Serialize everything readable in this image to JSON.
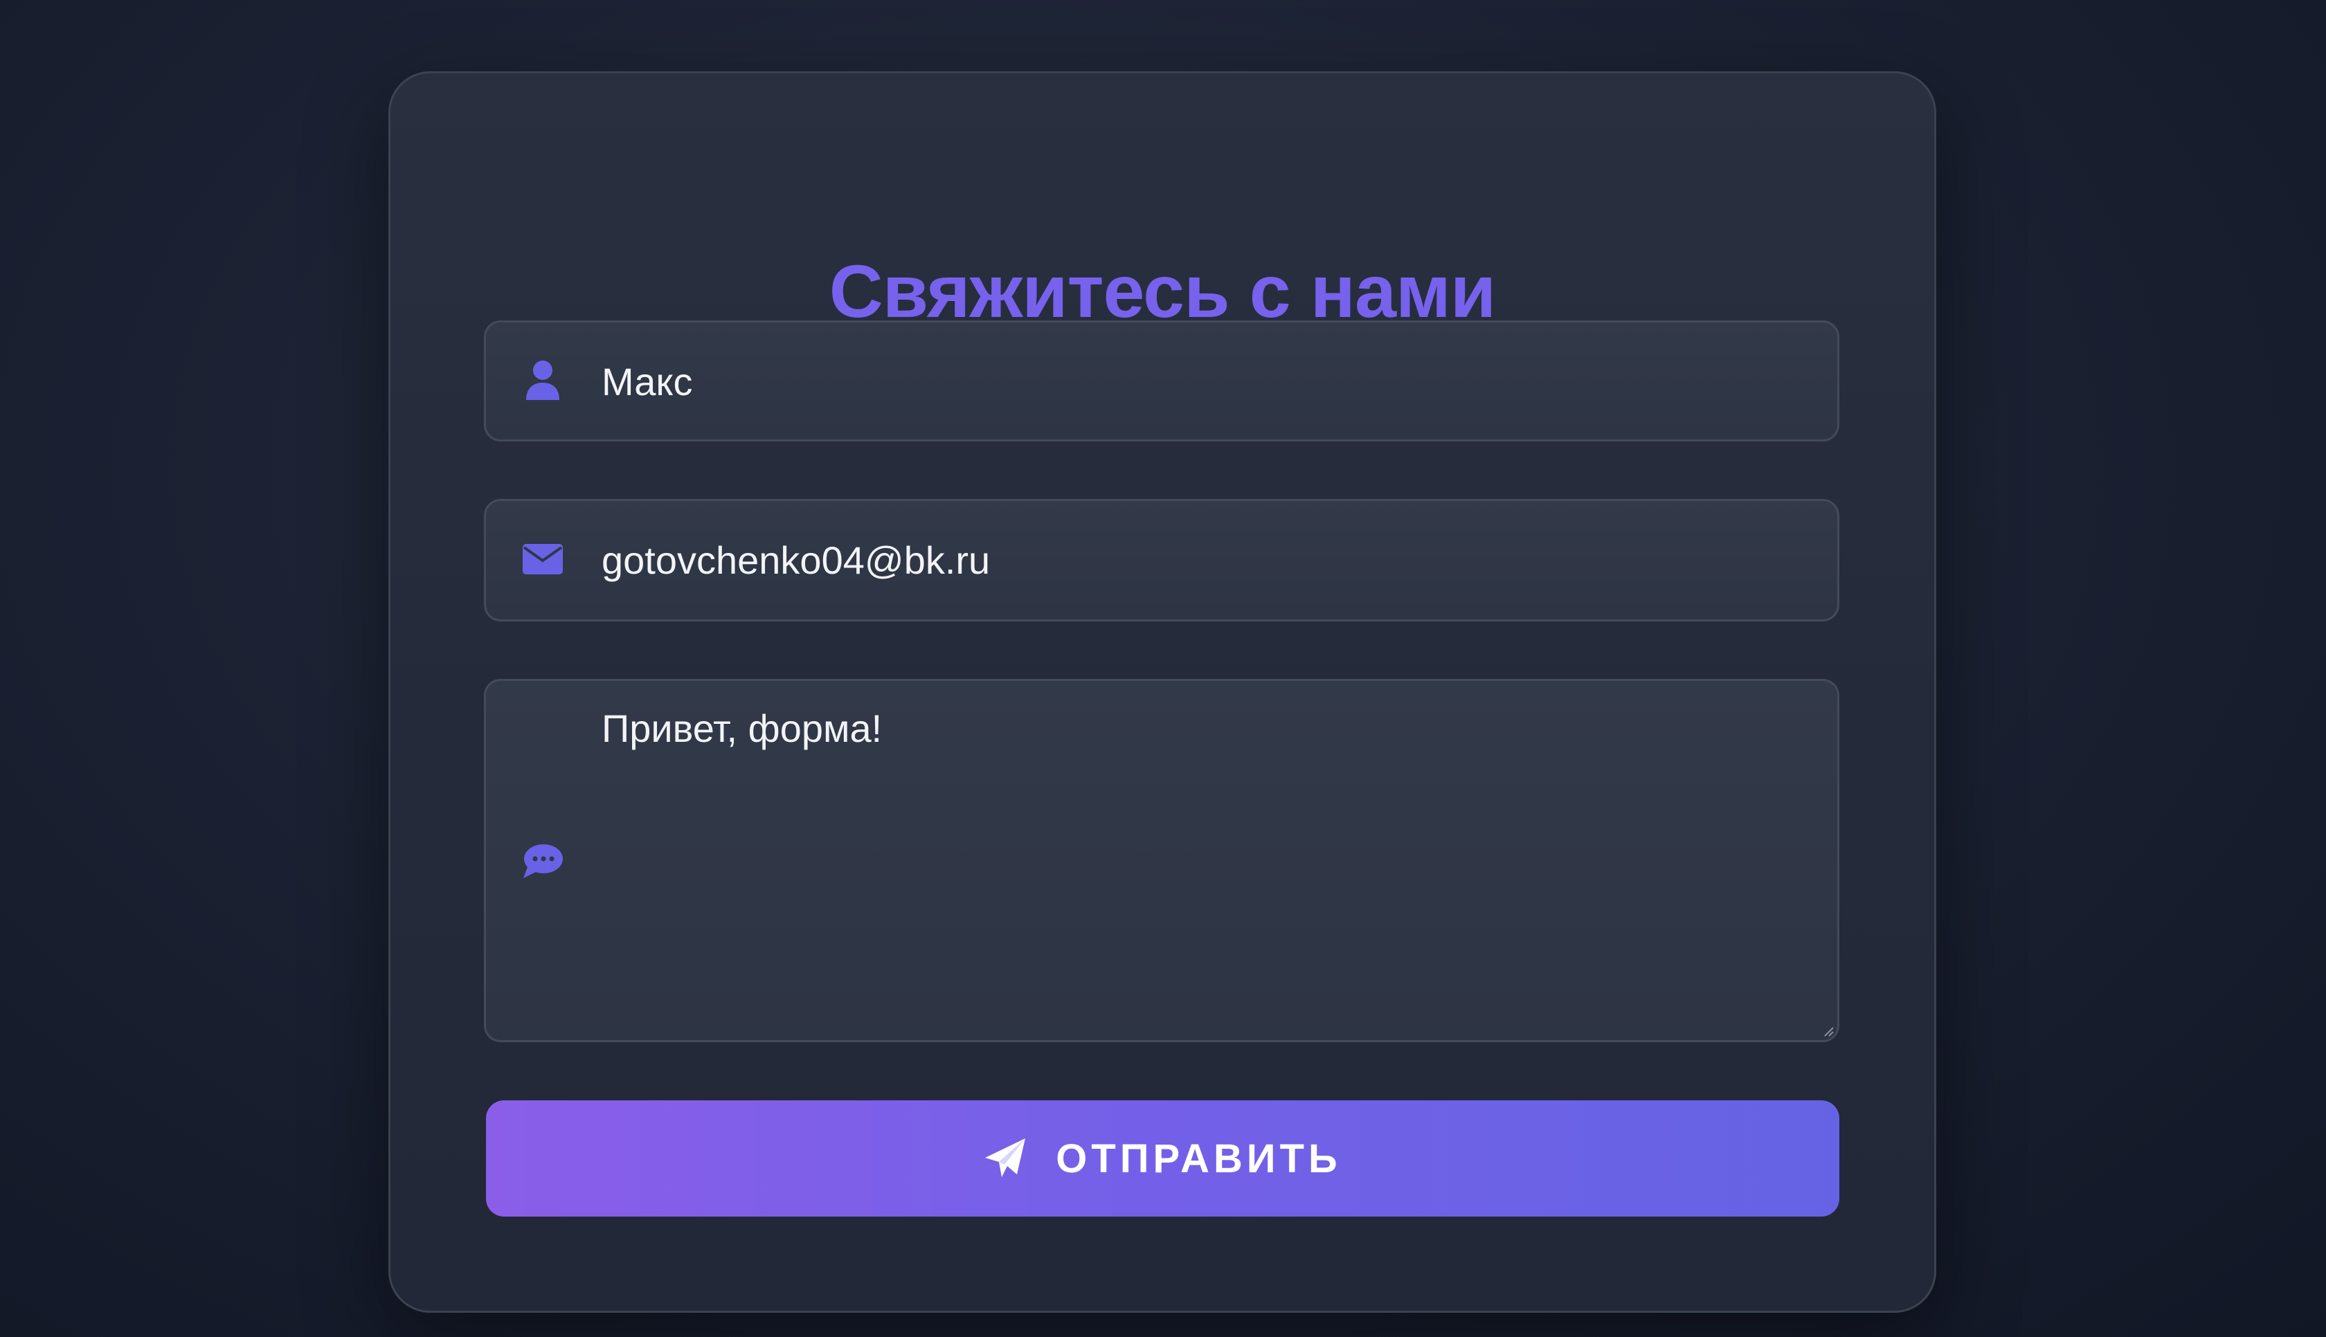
{
  "form": {
    "title": "Свяжитесь с нами",
    "name_field": {
      "icon": "user-icon",
      "value": "Макс"
    },
    "email_field": {
      "icon": "envelope-icon",
      "value": "gotovchenko04@bk.ru"
    },
    "message_field": {
      "icon": "chat-bubble-icon",
      "value": "Привет, форма!"
    },
    "submit": {
      "icon": "paper-plane-icon",
      "label": "ОТПРАВИТЬ"
    }
  },
  "colors": {
    "accent": "#7662ec",
    "button_gradient_start": "#8a5ee9",
    "button_gradient_end": "#6563e4",
    "background": "#1c2233",
    "card": "#262c3b",
    "input_background": "#303747",
    "text": "#f3f4f8"
  }
}
